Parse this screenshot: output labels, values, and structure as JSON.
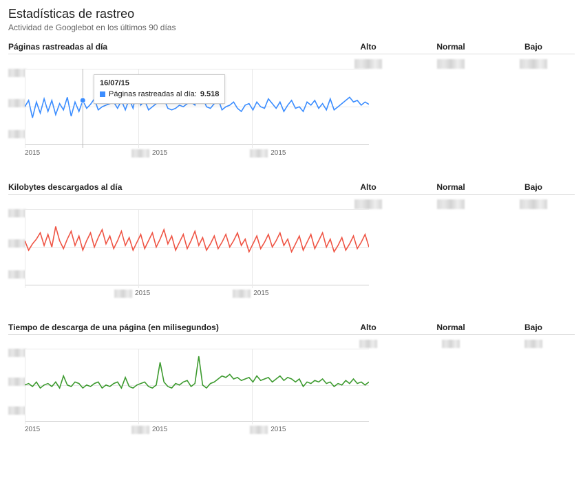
{
  "page": {
    "title": "Estadísticas de rastreo",
    "subtitle": "Actividad de Googlebot en los últimos 90 días"
  },
  "columns": {
    "high": "Alto",
    "normal": "Normal",
    "low": "Bajo"
  },
  "tooltip": {
    "date": "16/07/15",
    "label": "Páginas rastreadas al día:",
    "value": "9.518"
  },
  "axis": {
    "year": "2015"
  },
  "sections": [
    {
      "title": "Páginas rastreadas al día"
    },
    {
      "title": "Kilobytes descargados al día"
    },
    {
      "title": "Tiempo de descarga de una página (en milisegundos)"
    }
  ],
  "chart_data": [
    {
      "type": "line",
      "title": "Páginas rastreadas al día",
      "xlabel": "",
      "ylabel": "",
      "color": "#3b8dff",
      "x_ticks": [
        "2015",
        "2015",
        "2015"
      ],
      "values": [
        52,
        60,
        38,
        58,
        44,
        62,
        46,
        60,
        42,
        56,
        48,
        64,
        40,
        58,
        46,
        60,
        50,
        55,
        62,
        48,
        52,
        54,
        56,
        58,
        50,
        60,
        48,
        62,
        50,
        74,
        54,
        60,
        48,
        52,
        56,
        60,
        62,
        50,
        48,
        50,
        54,
        52,
        56,
        58,
        54,
        90,
        64,
        52,
        50,
        56,
        62,
        48,
        52,
        54,
        58,
        50,
        46,
        54,
        56,
        48,
        58,
        52,
        50,
        62,
        56,
        50,
        58,
        46,
        54,
        60,
        50,
        52,
        46,
        58,
        54,
        60,
        50,
        56,
        48,
        62,
        48,
        52,
        56,
        60,
        64,
        58,
        60,
        54,
        58,
        55
      ],
      "hover": {
        "index": 15,
        "date": "16/07/15",
        "label": "Páginas rastreadas al día",
        "value": 9518
      }
    },
    {
      "type": "line",
      "title": "Kilobytes descargados al día",
      "xlabel": "",
      "ylabel": "",
      "color": "#ef5444",
      "x_ticks": [
        "2015",
        "2015"
      ],
      "values": [
        60,
        48,
        56,
        62,
        70,
        54,
        68,
        52,
        78,
        60,
        50,
        62,
        72,
        54,
        66,
        48,
        60,
        70,
        52,
        64,
        74,
        56,
        66,
        50,
        60,
        72,
        54,
        64,
        48,
        58,
        68,
        50,
        60,
        70,
        52,
        62,
        74,
        56,
        66,
        48,
        58,
        68,
        50,
        60,
        72,
        54,
        64,
        48,
        56,
        66,
        50,
        58,
        68,
        52,
        60,
        70,
        54,
        62,
        46,
        56,
        66,
        50,
        58,
        68,
        52,
        60,
        70,
        54,
        62,
        46,
        56,
        66,
        48,
        58,
        68,
        50,
        60,
        70,
        52,
        62,
        46,
        54,
        64,
        48,
        56,
        66,
        50,
        58,
        68,
        52
      ]
    },
    {
      "type": "line",
      "title": "Tiempo de descarga de una página (en milisegundos)",
      "xlabel": "",
      "ylabel": "",
      "color": "#3c9a2e",
      "x_ticks": [
        "2015",
        "2015"
      ],
      "values": [
        52,
        54,
        50,
        56,
        48,
        52,
        54,
        50,
        56,
        48,
        64,
        52,
        50,
        56,
        54,
        48,
        52,
        50,
        54,
        56,
        48,
        52,
        50,
        54,
        56,
        48,
        62,
        50,
        48,
        52,
        54,
        56,
        50,
        48,
        52,
        82,
        56,
        50,
        48,
        54,
        52,
        56,
        58,
        50,
        54,
        90,
        52,
        48,
        54,
        56,
        60,
        64,
        62,
        66,
        60,
        62,
        58,
        60,
        62,
        56,
        64,
        58,
        60,
        62,
        56,
        60,
        64,
        58,
        62,
        60,
        56,
        60,
        50,
        56,
        54,
        58,
        56,
        60,
        54,
        56,
        50,
        54,
        52,
        58,
        54,
        60,
        54,
        56,
        52,
        56
      ]
    }
  ]
}
